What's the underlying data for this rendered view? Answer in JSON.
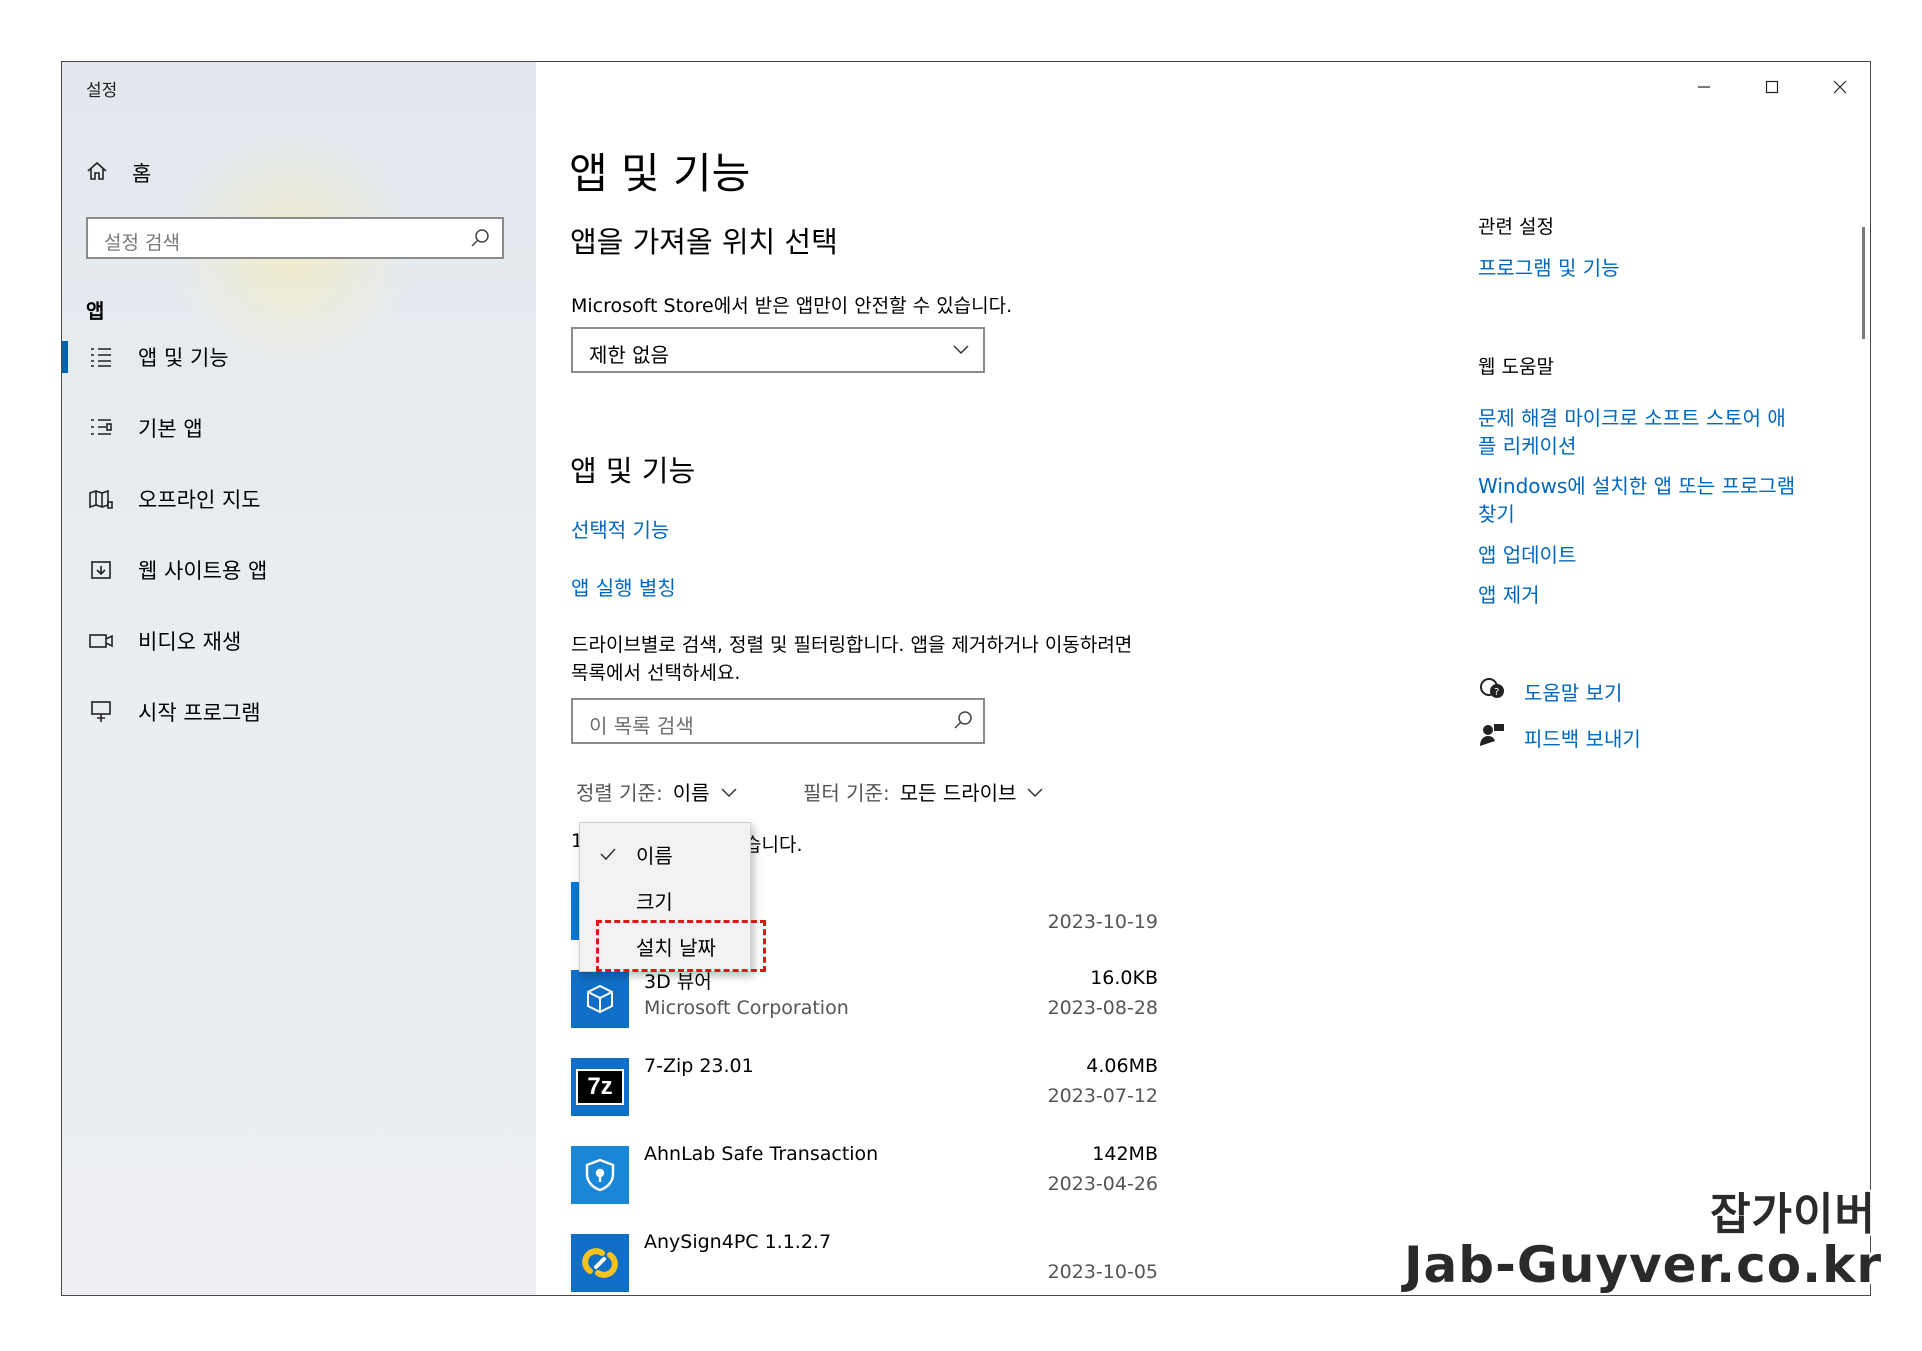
{
  "window": {
    "title": "설정"
  },
  "sidebar": {
    "home_label": "홈",
    "search_placeholder": "설정 검색",
    "section_label": "앱",
    "items": [
      {
        "label": "앱 및 기능",
        "icon": "list-icon",
        "active": true
      },
      {
        "label": "기본 앱",
        "icon": "default-apps-icon",
        "active": false
      },
      {
        "label": "오프라인 지도",
        "icon": "map-icon",
        "active": false
      },
      {
        "label": "웹 사이트용 앱",
        "icon": "website-app-icon",
        "active": false
      },
      {
        "label": "비디오 재생",
        "icon": "video-icon",
        "active": false
      },
      {
        "label": "시작 프로그램",
        "icon": "startup-icon",
        "active": false
      }
    ]
  },
  "main": {
    "title": "앱 및 기능",
    "install_section": {
      "heading": "앱을 가져올 위치 선택",
      "description": "Microsoft Store에서 받은 앱만이 안전할 수 있습니다.",
      "dropdown_value": "제한 없음"
    },
    "apps_section": {
      "heading": "앱 및 기능",
      "links": [
        "선택적 기능",
        "앱 실행 별칭"
      ],
      "description_line1": "드라이브별로 검색, 정렬 및 필터링합니다. 앱을 제거하거나 이동하려면",
      "description_line2": "목록에서 선택하세요.",
      "search_placeholder": "이 목록 검색",
      "sort_label": "정렬 기준:",
      "sort_value": "이름",
      "filter_label": "필터 기준:",
      "filter_value": "모든 드라이브",
      "found_prefix": "1",
      "found_suffix": "습니다.",
      "sort_menu": [
        {
          "label": "이름",
          "checked": true
        },
        {
          "label": "크기",
          "checked": false
        },
        {
          "label": "설치 날짜",
          "checked": false
        }
      ],
      "first_app_date": "2023-10-19",
      "apps": [
        {
          "name": "3D 뷰어",
          "publisher": "Microsoft Corporation",
          "size": "16.0KB",
          "date": "2023-08-28",
          "icon": "cube-icon"
        },
        {
          "name": "7-Zip 23.01",
          "publisher": "",
          "size": "4.06MB",
          "date": "2023-07-12",
          "icon": "7zip-icon",
          "icon_text": "7z"
        },
        {
          "name": "AhnLab Safe Transaction",
          "publisher": "",
          "size": "142MB",
          "date": "2023-04-26",
          "icon": "shield-icon"
        },
        {
          "name": "AnySign4PC 1.1.2.7",
          "publisher": "",
          "size": "",
          "date": "2023-10-05",
          "icon": "anysign-icon"
        }
      ]
    }
  },
  "related": {
    "heading1": "관련 설정",
    "link1": "프로그램 및 기능",
    "heading2": "웹 도움말",
    "links2": [
      {
        "line1": "문제 해결 마이크로 소프트 스토어 애",
        "line2": "플 리케이션"
      },
      {
        "line1": "Windows에 설치한 앱 또는 프로그램",
        "line2": "찾기"
      },
      {
        "line1": "앱 업데이트",
        "line2": ""
      },
      {
        "line1": "앱 제거",
        "line2": ""
      }
    ],
    "help_label": "도움말 보기",
    "feedback_label": "피드백 보내기"
  },
  "watermark": {
    "line1": "잡가이버",
    "line2": "Jab-Guyver.co.kr"
  },
  "colors": {
    "accent": "#0067c0",
    "active_indicator": "#0063b1",
    "highlight": "#e01616"
  }
}
